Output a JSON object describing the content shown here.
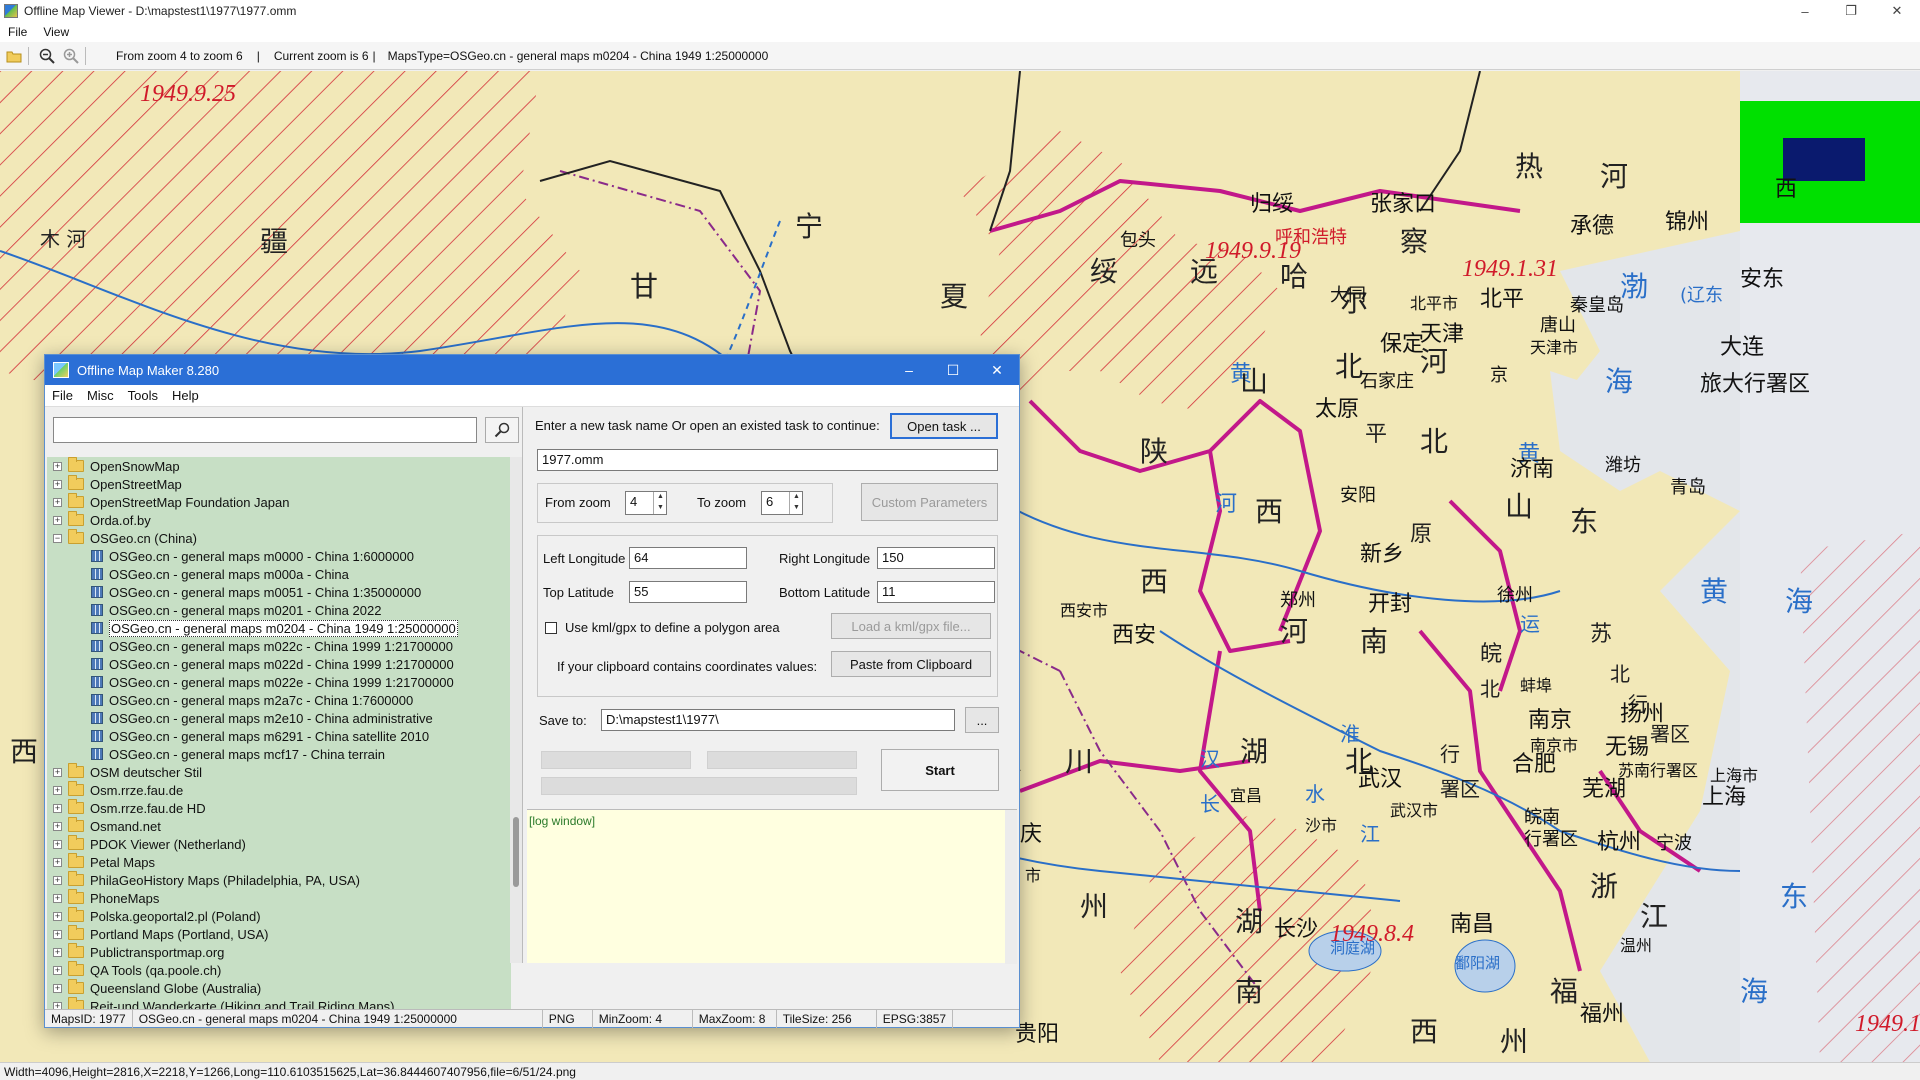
{
  "window": {
    "title": "Offline Map Viewer - D:\\mapstest1\\1977\\1977.omm"
  },
  "menu": [
    "File",
    "View"
  ],
  "toolbar": {
    "zoom_range": "From zoom 4 to zoom 6",
    "current_zoom": "Current zoom is 6",
    "maps_type": "MapsType=OSGeo.cn - general maps m0204 - China 1949 1:25000000"
  },
  "map_labels": {
    "date1": "1949.9.25",
    "date2": "1949.9.19",
    "date3": "1949.1.31",
    "date4": "1949.8.4",
    "date5": "1949.1",
    "xinjiang_1": "疆",
    "river": "木 河",
    "ningxia": "宁",
    "gansu": "甘",
    "xia": "夏",
    "suiyuan_1": "绥",
    "suiyuan_2": "远",
    "guisui": "归绥",
    "huhehaote": "呼和浩特",
    "baotou": "包头",
    "zhangjiakou": "张家口",
    "cha": "察",
    "ha": "哈",
    "er": "尔",
    "datong": "大同",
    "rehe_1": "热",
    "rehe_2": "河",
    "jinzhou": "锦州",
    "chengde": "承德",
    "xi": "西",
    "anshan": "安东",
    "qinhuangdao": "秦皇岛",
    "tangshan": "唐山",
    "beiping": "北平",
    "beipingshi": "北平市",
    "tianjin": "天津",
    "tianjinshi": "天津市",
    "baoding": "保定",
    "hebei_he": "河",
    "jing": "京",
    "dalian": "大连",
    "ludaxingshu": "旅大行署区",
    "bohai_1": "渤",
    "bohai_2": "海",
    "shanxi_huang": "黄",
    "shanxi_shan": "山",
    "taiyuan": "太原",
    "shijiazhuang": "石家庄",
    "bei": "北",
    "shaanxi_1": "陕",
    "shaanxi_he": "河",
    "shaanxi_xi": "西",
    "anyang": "安阳",
    "pingyuan_1": "平",
    "pingyuan_2": "原",
    "xinxiang": "新乡",
    "jinan": "济南",
    "weifang": "潍坊",
    "qingdao": "青岛",
    "shandong_shan": "山",
    "shandong_dong": "东",
    "huang_he": "黄",
    "xi_2": "西",
    "xian_city": "西安市",
    "xian": "西安",
    "zhengzhou": "郑州",
    "kaifeng": "开封",
    "henan_he": "河",
    "henan_nan": "南",
    "xuzhou": "徐州",
    "huanghai_1": "黄",
    "huanghai_2": "海",
    "yun": "运",
    "su": "苏",
    "wan": "皖",
    "wanbei_1": "北",
    "bengbu": "蚌埠",
    "xingshu": "行",
    "shuqu": "署区",
    "nanjing": "南京",
    "nanjingshi": "南京市",
    "yangzhou": "扬州",
    "wuxi": "无锡",
    "hefei": "合肥",
    "sunan": "苏南行署区",
    "shanghai_shi": "上海市",
    "shanghai": "上海",
    "wuhu": "芜湖",
    "wannan": "皖南",
    "wannan2": "行署区",
    "hangzhou": "杭州",
    "ningbo": "宁波",
    "zhe": "浙",
    "jiang": "江",
    "dong": "东",
    "hubei_hu": "湖",
    "hubei_bei": "北",
    "yichang": "宜昌",
    "shashi": "沙市",
    "chuan": "川",
    "wuhan": "武汉",
    "wuhanshi": "武汉市",
    "dongtinghu": "洞庭湖",
    "poyanghu": "鄱阳湖",
    "hunan_hu": "湖",
    "hunan_nan": "南",
    "changsha": "长沙",
    "nanchang": "南昌",
    "jiangxi_xi": "西",
    "fuzhou": "福州",
    "fu": "福",
    "zhou": "州",
    "guiyang": "贵阳",
    "wenzhou": "温州",
    "zhou2": "州",
    "chongqing": "庆",
    "shishi": "市",
    "liaodong": "(辽东",
    "chang": "长",
    "shui": "水",
    "han": "汉",
    "huai": "淮",
    "jiang2": "江"
  },
  "dialog": {
    "title": "Offline Map Maker 8.280",
    "menu": [
      "File",
      "Misc",
      "Tools",
      "Help"
    ],
    "search": {
      "value": ""
    },
    "tree": [
      {
        "label": "OpenSnowMap",
        "type": "folder",
        "expanded": false
      },
      {
        "label": "OpenStreetMap",
        "type": "folder",
        "expanded": false
      },
      {
        "label": "OpenStreetMap Foundation Japan",
        "type": "folder",
        "expanded": false
      },
      {
        "label": "Orda.of.by",
        "type": "folder",
        "expanded": false
      },
      {
        "label": "OSGeo.cn (China)",
        "type": "folder",
        "expanded": true
      },
      {
        "label": "OSGeo.cn - general maps m0000 - China 1:6000000",
        "type": "map"
      },
      {
        "label": "OSGeo.cn - general maps m000a - China",
        "type": "map"
      },
      {
        "label": "OSGeo.cn - general maps m0051 - China 1:35000000",
        "type": "map"
      },
      {
        "label": "OSGeo.cn - general maps m0201 - China 2022",
        "type": "map"
      },
      {
        "label": "OSGeo.cn - general maps m0204 - China 1949 1:25000000",
        "type": "map",
        "selected": true
      },
      {
        "label": "OSGeo.cn - general maps m022c - China 1999 1:21700000",
        "type": "map"
      },
      {
        "label": "OSGeo.cn - general maps m022d - China 1999 1:21700000",
        "type": "map"
      },
      {
        "label": "OSGeo.cn - general maps m022e - China 1999 1:21700000",
        "type": "map"
      },
      {
        "label": "OSGeo.cn - general maps m2a7c - China 1:7600000",
        "type": "map"
      },
      {
        "label": "OSGeo.cn - general maps m2e10 - China administrative",
        "type": "map"
      },
      {
        "label": "OSGeo.cn - general maps m6291 - China satellite 2010",
        "type": "map"
      },
      {
        "label": "OSGeo.cn - general maps mcf17 - China terrain",
        "type": "map"
      },
      {
        "label": "OSM deutscher Stil",
        "type": "folder",
        "expanded": false
      },
      {
        "label": "Osm.rrze.fau.de",
        "type": "folder",
        "expanded": false
      },
      {
        "label": "Osm.rrze.fau.de HD",
        "type": "folder",
        "expanded": false
      },
      {
        "label": "Osmand.net",
        "type": "folder",
        "expanded": false
      },
      {
        "label": "PDOK Viewer (Netherland)",
        "type": "folder",
        "expanded": false
      },
      {
        "label": "Petal Maps",
        "type": "folder",
        "expanded": false
      },
      {
        "label": "PhilaGeoHistory Maps (Philadelphia, PA, USA)",
        "type": "folder",
        "expanded": false
      },
      {
        "label": "PhoneMaps",
        "type": "folder",
        "expanded": false
      },
      {
        "label": "Polska.geoportal2.pl (Poland)",
        "type": "folder",
        "expanded": false
      },
      {
        "label": "Portland Maps (Portland, USA)",
        "type": "folder",
        "expanded": false
      },
      {
        "label": "Publictransportmap.org",
        "type": "folder",
        "expanded": false
      },
      {
        "label": "QA Tools (qa.poole.ch)",
        "type": "folder",
        "expanded": false
      },
      {
        "label": "Queensland Globe (Australia)",
        "type": "folder",
        "expanded": false
      },
      {
        "label": "Reit-und Wanderkarte (Hiking and Trail Riding Maps)",
        "type": "folder",
        "expanded": false
      }
    ],
    "task_prompt": "Enter a new task name Or open an existed task to continue:",
    "open_task_label": "Open task ...",
    "task_name": "1977.omm",
    "from_zoom_label": "From zoom",
    "from_zoom": "4",
    "to_zoom_label": "To zoom",
    "to_zoom": "6",
    "custom_params_label": "Custom Parameters",
    "left_lon_label": "Left Longitude",
    "left_lon": "64",
    "right_lon_label": "Right Longitude",
    "right_lon": "150",
    "top_lat_label": "Top Latitude",
    "top_lat": "55",
    "bottom_lat_label": "Bottom Latitude",
    "bottom_lat": "11",
    "kml_label": "Use kml/gpx to define a polygon area",
    "load_kml_label": "Load a kml/gpx file...",
    "clipboard_prompt": "If your clipboard contains coordinates values:",
    "paste_label": "Paste from Clipboard",
    "save_to_label": "Save to:",
    "save_to": "D:\\mapstest1\\1977\\",
    "browse_label": "...",
    "start_label": "Start",
    "log_label": "[log window]",
    "status": {
      "maps_id": "MapsID: 1977",
      "map_name": "OSGeo.cn - general maps m0204 - China 1949 1:25000000",
      "format": "PNG",
      "min_zoom": "MinZoom: 4",
      "max_zoom": "MaxZoom: 8",
      "tile_size": "TileSize: 256",
      "epsg": "EPSG:3857"
    }
  },
  "statusbar": "Width=4096,Height=2816,X=2218,Y=1266,Long=110.6103515625,Lat=36.8444607407956,file=6/51/24.png",
  "colors": {
    "land": "#f2e8b8",
    "border": "#c2188a",
    "hatch": "#d01a2a",
    "water": "#2a6fc8",
    "tree_bg": "#c7dfc5",
    "accent": "#2b6fd6"
  }
}
